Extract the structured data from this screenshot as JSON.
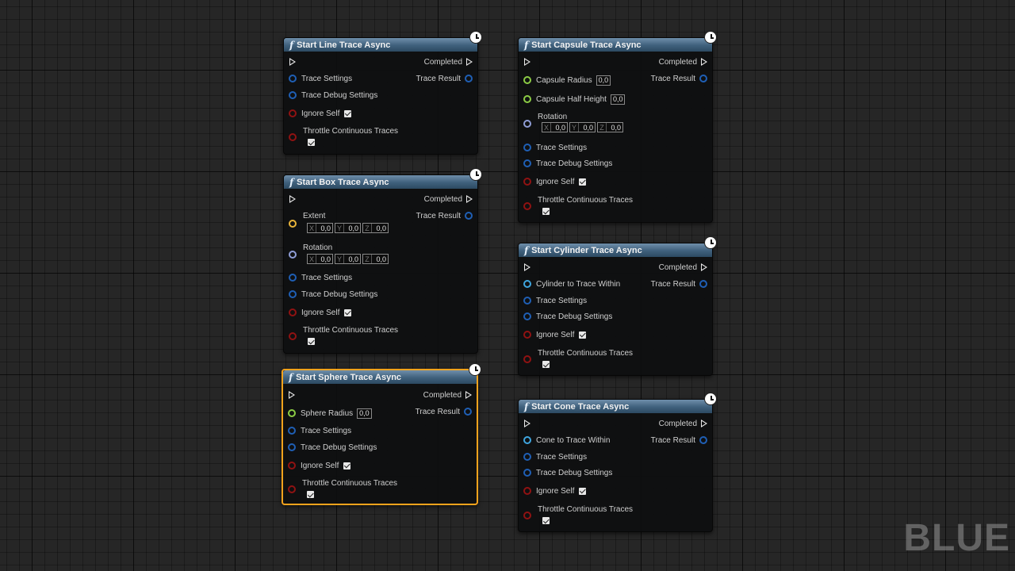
{
  "common": {
    "completed": "Completed",
    "trace_result": "Trace Result",
    "trace_settings": "Trace Settings",
    "trace_debug_settings": "Trace Debug Settings",
    "ignore_self": "Ignore Self",
    "throttle": "Throttle Continuous Traces",
    "axis_x": "X",
    "axis_y": "Y",
    "axis_z": "Z",
    "zero": "0,0",
    "function_glyph": "f"
  },
  "nodes": {
    "line": {
      "title": "Start Line Trace Async"
    },
    "box": {
      "title": "Start Box Trace Async",
      "extent": "Extent",
      "rotation": "Rotation"
    },
    "sphere": {
      "title": "Start Sphere Trace Async",
      "sphere_radius": "Sphere Radius"
    },
    "capsule": {
      "title": "Start Capsule Trace Async",
      "capsule_radius": "Capsule Radius",
      "capsule_half_height": "Capsule Half Height",
      "rotation": "Rotation"
    },
    "cylinder": {
      "title": "Start Cylinder Trace Async",
      "within": "Cylinder to Trace Within"
    },
    "cone": {
      "title": "Start Cone Trace Async",
      "within": "Cone to Trace Within"
    }
  },
  "watermark": "BLUE"
}
